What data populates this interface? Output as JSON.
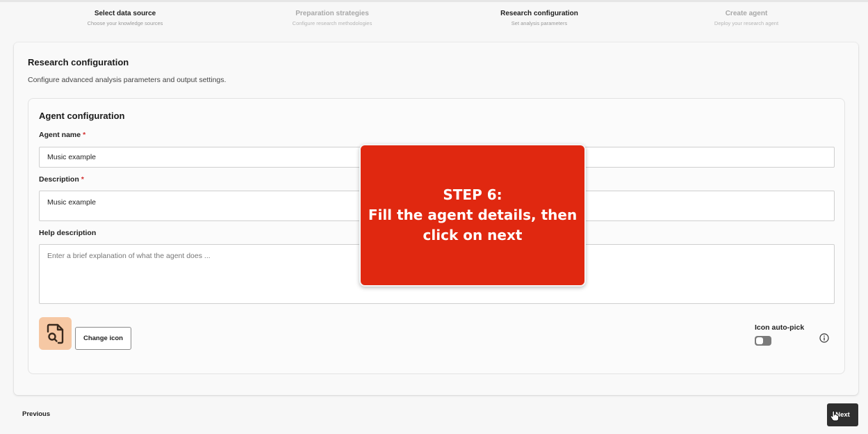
{
  "stepper": {
    "steps": [
      {
        "title": "Select data source",
        "subtitle": "Choose your knowledge sources"
      },
      {
        "title": "Preparation strategies",
        "subtitle": "Configure research methodologies"
      },
      {
        "title": "Research configuration",
        "subtitle": "Set analysis parameters"
      },
      {
        "title": "Create agent",
        "subtitle": "Deploy your research agent"
      }
    ]
  },
  "section": {
    "title": "Research configuration",
    "description": "Configure advanced analysis parameters and output settings."
  },
  "agent_config": {
    "title": "Agent configuration",
    "name_label": "Agent name",
    "name_value": "Music example",
    "description_label": "Description",
    "description_value": "Music example",
    "help_label": "Help description",
    "help_placeholder": "Enter a brief explanation of what the agent does ...",
    "required_mark": "*",
    "change_icon_label": "Change icon",
    "icon_autopick_label": "Icon auto-pick",
    "icon_autopick_enabled": false,
    "agent_icon": "document-search-icon",
    "accent_color": "#f6c8a4"
  },
  "footer": {
    "previous_label": "Previous",
    "next_label": "Next"
  },
  "callout": {
    "line1": "STEP 6:",
    "line2": "Fill the agent details, then",
    "line3": "click on next",
    "color": "#e02810"
  }
}
